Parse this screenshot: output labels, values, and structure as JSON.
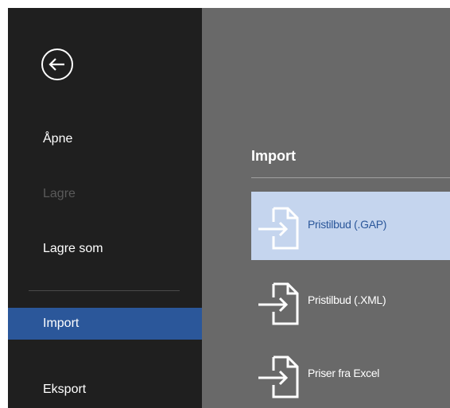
{
  "sidebar": {
    "items": [
      {
        "label": "Åpne",
        "state": "normal"
      },
      {
        "label": "Lagre",
        "state": "disabled"
      },
      {
        "label": "Lagre som",
        "state": "normal"
      },
      {
        "label": "Import",
        "state": "active"
      },
      {
        "label": "Eksport",
        "state": "normal"
      }
    ]
  },
  "main": {
    "section_title": "Import",
    "items": [
      {
        "label": "Pristilbud (.GAP)",
        "icon": "import-file-icon"
      },
      {
        "label": "Pristilbud (.XML)",
        "icon": "import-file-icon"
      },
      {
        "label": "Priser fra Excel",
        "icon": "import-file-icon"
      }
    ]
  },
  "colors": {
    "sidebar_bg": "#1f1f1f",
    "main_bg": "#696969",
    "accent": "#2b579a",
    "selected_item_bg": "#c5d5ee"
  }
}
